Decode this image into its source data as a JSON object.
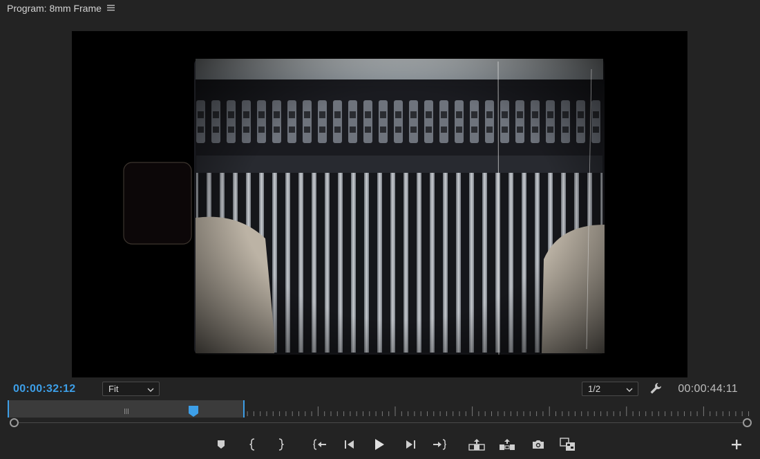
{
  "panel": {
    "title": "Program: 8mm Frame",
    "menu_icon": "hamburger-menu-icon"
  },
  "viewer": {
    "content": "video-frame"
  },
  "timecode": {
    "current": "00:00:32:12",
    "duration": "00:00:44:11"
  },
  "zoom": {
    "selected": "Fit"
  },
  "resolution": {
    "selected": "1/2"
  },
  "settings_icon": "wrench-icon",
  "playback": {
    "playhead_fraction": 0.245
  },
  "controls": [
    {
      "id": "add-marker",
      "icon": "marker-icon"
    },
    {
      "id": "mark-in",
      "icon": "mark-in-icon"
    },
    {
      "id": "mark-out",
      "icon": "mark-out-icon"
    },
    {
      "id": "go-to-in",
      "icon": "go-to-in-icon"
    },
    {
      "id": "step-back",
      "icon": "step-back-icon"
    },
    {
      "id": "play",
      "icon": "play-icon"
    },
    {
      "id": "step-forward",
      "icon": "step-forward-icon"
    },
    {
      "id": "go-to-out",
      "icon": "go-to-out-icon"
    },
    {
      "id": "lift",
      "icon": "lift-icon"
    },
    {
      "id": "extract",
      "icon": "extract-icon"
    },
    {
      "id": "export-frame",
      "icon": "camera-icon"
    },
    {
      "id": "comparison-view",
      "icon": "comparison-view-icon"
    },
    {
      "id": "button-editor",
      "icon": "plus-icon"
    }
  ],
  "colors": {
    "accent": "#3d9fe8",
    "background": "#232323",
    "viewer_bg": "#000000"
  }
}
